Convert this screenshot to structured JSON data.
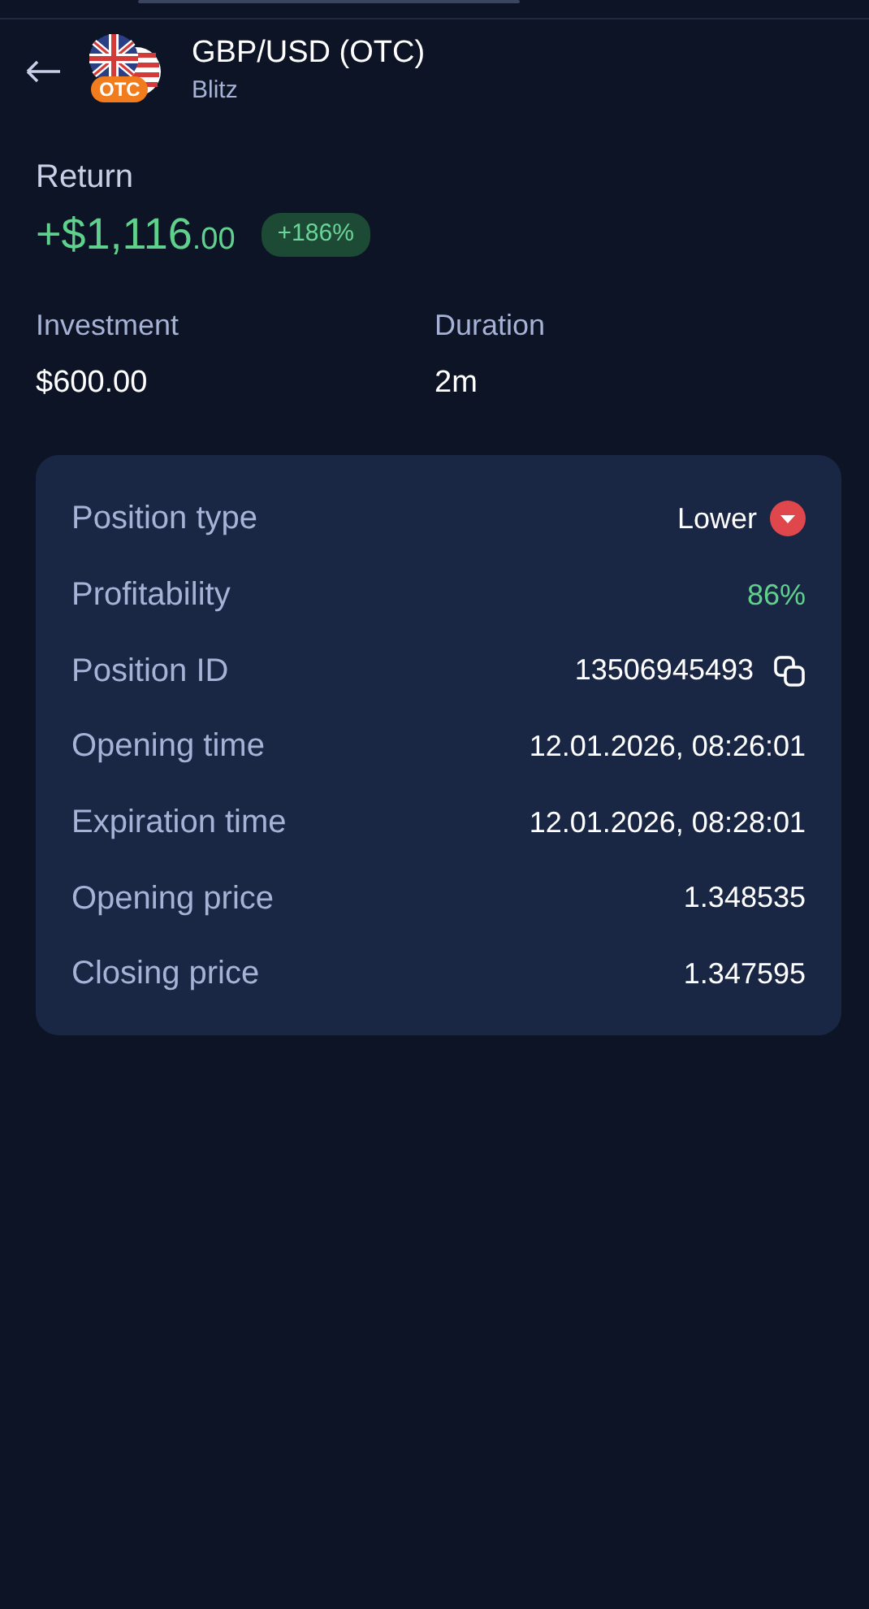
{
  "header": {
    "title": "GBP/USD (OTC)",
    "subtitle": "Blitz",
    "badge": "OTC"
  },
  "return": {
    "label": "Return",
    "amount": "+$1,116",
    "cents": ".00",
    "percent": "+186%"
  },
  "summary": [
    {
      "label": "Investment",
      "value": "$600.00"
    },
    {
      "label": "Duration",
      "value": "2m"
    }
  ],
  "details": [
    {
      "kind": "direction",
      "label": "Position type",
      "value": "Lower"
    },
    {
      "kind": "positive",
      "label": "Profitability",
      "value": "86%"
    },
    {
      "kind": "copy",
      "label": "Position ID",
      "value": "13506945493"
    },
    {
      "kind": "plain",
      "label": "Opening time",
      "value": "12.01.2026, 08:26:01"
    },
    {
      "kind": "plain",
      "label": "Expiration time",
      "value": "12.01.2026, 08:28:01"
    },
    {
      "kind": "plain",
      "label": "Opening price",
      "value": "1.348535"
    },
    {
      "kind": "plain",
      "label": "Closing price",
      "value": "1.347595"
    }
  ]
}
